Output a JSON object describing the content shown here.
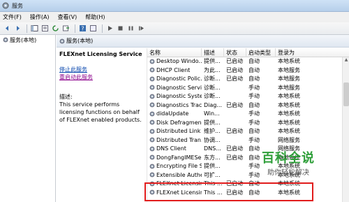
{
  "window": {
    "title": "服务"
  },
  "menu": [
    "文件(F)",
    "操作(A)",
    "查看(V)",
    "帮助(H)"
  ],
  "toolbar": {
    "icons": [
      "back-icon",
      "forward-icon",
      "console-tree-icon",
      "properties-icon",
      "refresh-icon",
      "export-icon",
      "help-icon",
      "start-icon",
      "stop-icon",
      "pause-icon",
      "restart-icon"
    ]
  },
  "tree": {
    "root_label": "服务(本地)"
  },
  "pane": {
    "header_label": "服务(本地)"
  },
  "details": {
    "service_name": "FLEXnet Licensing Service",
    "stop_link": "停止此服务",
    "restart_link": "重启动此服务",
    "desc_label": "描述:",
    "desc_text": "This service performs licensing functions on behalf of FLEXnet enabled products."
  },
  "columns": [
    "名称",
    "描述",
    "状态",
    "启动类型",
    "登录为"
  ],
  "services": [
    {
      "name": "Desktop Windo...",
      "desc": "提供...",
      "status": "已启动",
      "startup": "自动",
      "logon": "本地系统"
    },
    {
      "name": "DHCP Client",
      "desc": "为此...",
      "status": "已启动",
      "startup": "自动",
      "logon": "本地服务"
    },
    {
      "name": "Diagnostic Polic...",
      "desc": "诊断...",
      "status": "已启动",
      "startup": "自动",
      "logon": "本地服务"
    },
    {
      "name": "Diagnostic Servi...",
      "desc": "诊断...",
      "status": "",
      "startup": "手动",
      "logon": "本地服务"
    },
    {
      "name": "Diagnostic Syste...",
      "desc": "诊断...",
      "status": "",
      "startup": "手动",
      "logon": "本地系统"
    },
    {
      "name": "Diagnostics Trac...",
      "desc": "Diag...",
      "status": "已启动",
      "startup": "自动",
      "logon": "本地系统"
    },
    {
      "name": "didaUpdate",
      "desc": "Win...",
      "status": "",
      "startup": "手动",
      "logon": "本地系统"
    },
    {
      "name": "Disk Defragmen...",
      "desc": "提供...",
      "status": "",
      "startup": "手动",
      "logon": "本地系统"
    },
    {
      "name": "Distributed Link ...",
      "desc": "维护...",
      "status": "已启动",
      "startup": "自动",
      "logon": "本地系统"
    },
    {
      "name": "Distributed Tran...",
      "desc": "协调...",
      "status": "",
      "startup": "手动",
      "logon": "网络服务"
    },
    {
      "name": "DNS Client",
      "desc": "DNS...",
      "status": "已启动",
      "startup": "自动",
      "logon": "网络服务"
    },
    {
      "name": "DongFangIMESe...",
      "desc": "东方...",
      "status": "已启动",
      "startup": "自动",
      "logon": "本地系统"
    },
    {
      "name": "Encrypting File S...",
      "desc": "提供...",
      "status": "",
      "startup": "手动",
      "logon": "本地系统"
    },
    {
      "name": "Extensible Authe...",
      "desc": "可扩...",
      "status": "",
      "startup": "手动",
      "logon": "本地系统"
    },
    {
      "name": "FLEXnet Licensin...",
      "desc": "This ...",
      "status": "已启动",
      "startup": "自动",
      "logon": "本地系统"
    },
    {
      "name": "FLEXnet Licensin...",
      "desc": "This ...",
      "status": "已启动",
      "startup": "自动",
      "logon": "本地系统"
    }
  ],
  "watermark": {
    "main": "百科全说",
    "sub": "助你轻松解决"
  },
  "colors": {
    "highlight": "#e11b1b",
    "link": "#0645ad",
    "watermark": "#2f9f3a"
  }
}
